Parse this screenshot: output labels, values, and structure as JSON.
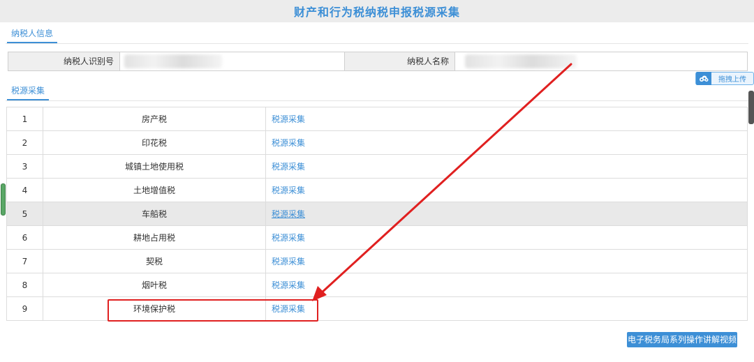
{
  "page_title": "财产和行为税纳税申报税源采集",
  "taxpayer_section": {
    "tab_label": "纳税人信息",
    "id_label": "纳税人识别号",
    "name_label": "纳税人名称"
  },
  "upload_button_label": "拖拽上传",
  "source_section": {
    "tab_label": "税源采集"
  },
  "tax_rows": [
    {
      "index": "1",
      "name": "房产税",
      "action": "税源采集"
    },
    {
      "index": "2",
      "name": "印花税",
      "action": "税源采集"
    },
    {
      "index": "3",
      "name": "城镇土地使用税",
      "action": "税源采集"
    },
    {
      "index": "4",
      "name": "土地增值税",
      "action": "税源采集"
    },
    {
      "index": "5",
      "name": "车船税",
      "action": "税源采集"
    },
    {
      "index": "6",
      "name": "耕地占用税",
      "action": "税源采集"
    },
    {
      "index": "7",
      "name": "契税",
      "action": "税源采集"
    },
    {
      "index": "8",
      "name": "烟叶税",
      "action": "税源采集"
    },
    {
      "index": "9",
      "name": "环境保护税",
      "action": "税源采集"
    }
  ],
  "video_button_label": "电子税务局系列操作讲解视频",
  "colors": {
    "accent": "#3d8fd6",
    "annotation": "#e02020"
  }
}
